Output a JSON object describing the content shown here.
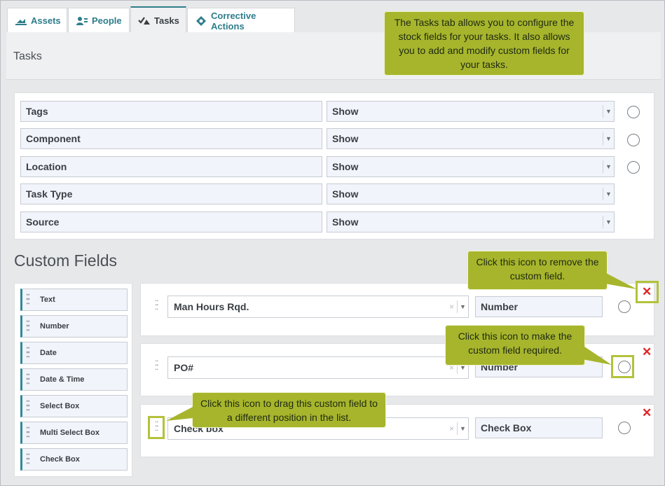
{
  "tabs": [
    {
      "label": "Assets",
      "icon": "assets-icon"
    },
    {
      "label": "People",
      "icon": "people-icon"
    },
    {
      "label": "Tasks",
      "icon": "tasks-icon"
    },
    {
      "label": "Corrective Actions",
      "icon": "corrective-actions-icon"
    }
  ],
  "active_tab": "Tasks",
  "header": {
    "title": "Tasks"
  },
  "stock_fields": [
    {
      "name": "Tags",
      "visibility": "Show",
      "has_required_toggle": true
    },
    {
      "name": "Component",
      "visibility": "Show",
      "has_required_toggle": true
    },
    {
      "name": "Location",
      "visibility": "Show",
      "has_required_toggle": true
    },
    {
      "name": "Task Type",
      "visibility": "Show",
      "has_required_toggle": false
    },
    {
      "name": "Source",
      "visibility": "Show",
      "has_required_toggle": false
    }
  ],
  "custom_fields_title": "Custom Fields",
  "palette": [
    "Text",
    "Number",
    "Date",
    "Date & Time",
    "Select Box",
    "Multi Select Box",
    "Check Box"
  ],
  "custom_fields": [
    {
      "name": "Man Hours Rqd.",
      "type": "Number"
    },
    {
      "name": "PO#",
      "type": "Number"
    },
    {
      "name": "Check box",
      "type": "Check Box"
    }
  ],
  "callouts": {
    "tasks_tab": "The Tasks tab allows you to configure the stock fields for your tasks. It also allows you to add and modify custom fields for your tasks.",
    "remove": "Click this icon to remove the custom field.",
    "required": "Click this icon to make the custom field required.",
    "drag": "Click this icon to drag this custom field to a different position in the list."
  },
  "colors": {
    "accent": "#2d7d8a",
    "callout": "#a7b52c",
    "remove": "#e02424"
  }
}
